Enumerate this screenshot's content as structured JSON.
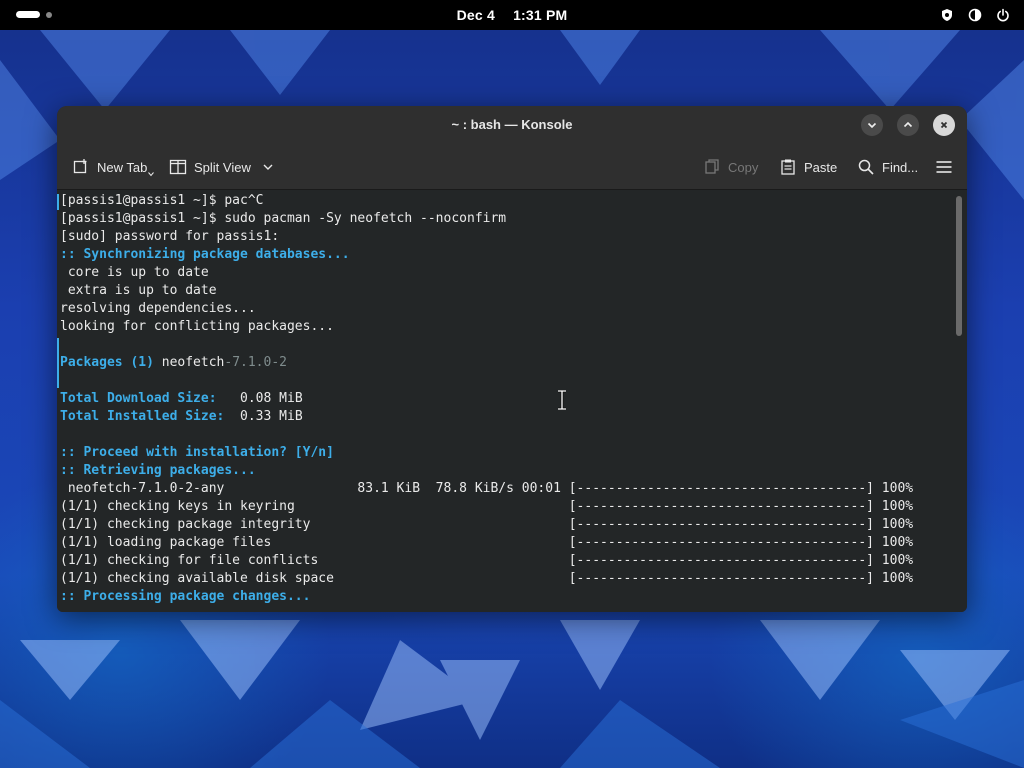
{
  "topbar": {
    "date": "Dec 4",
    "time": "1:31 PM",
    "tray_icons": [
      "shield-icon",
      "volume-icon",
      "power-icon"
    ]
  },
  "window": {
    "title": "~ : bash — Konsole",
    "controls": [
      "minimize",
      "maximize",
      "close"
    ]
  },
  "toolbar": {
    "new_tab": "New Tab",
    "split_view": "Split View",
    "copy": "Copy",
    "paste": "Paste",
    "find": "Find..."
  },
  "terminal": {
    "lines": [
      [
        {
          "t": "[passis1@passis1 ~]$ pac^C",
          "c": ""
        }
      ],
      [
        {
          "t": "[passis1@passis1 ~]$ sudo pacman -Sy neofetch --noconfirm",
          "c": ""
        }
      ],
      [
        {
          "t": "[sudo] password for passis1:",
          "c": ""
        }
      ],
      [
        {
          "t": ":: Synchronizing package databases...",
          "c": "blue"
        }
      ],
      [
        {
          "t": " core is up to date",
          "c": ""
        }
      ],
      [
        {
          "t": " extra is up to date",
          "c": ""
        }
      ],
      [
        {
          "t": "resolving dependencies...",
          "c": ""
        }
      ],
      [
        {
          "t": "looking for conflicting packages...",
          "c": ""
        }
      ],
      [
        {
          "t": "",
          "c": ""
        }
      ],
      [
        {
          "t": "Packages (1) ",
          "c": "blue"
        },
        {
          "t": "neofetch",
          "c": ""
        },
        {
          "t": "-7.1.0-2",
          "c": "gray"
        }
      ],
      [
        {
          "t": "",
          "c": ""
        }
      ],
      [
        {
          "t": "Total Download Size:",
          "c": "blue"
        },
        {
          "t": "   0.08 MiB",
          "c": ""
        }
      ],
      [
        {
          "t": "Total Installed Size:",
          "c": "blue"
        },
        {
          "t": "  0.33 MiB",
          "c": ""
        }
      ],
      [
        {
          "t": "",
          "c": ""
        }
      ],
      [
        {
          "t": ":: Proceed with installation? [Y/n]",
          "c": "blue"
        }
      ],
      [
        {
          "t": ":: Retrieving packages...",
          "c": "blue"
        }
      ],
      [
        {
          "t": " neofetch-7.1.0-2-any                 83.1 KiB  78.8 KiB/s 00:01 [-------------------------------------] 100%",
          "c": ""
        }
      ],
      [
        {
          "t": "(1/1) checking keys in keyring                                   [-------------------------------------] 100%",
          "c": ""
        }
      ],
      [
        {
          "t": "(1/1) checking package integrity                                 [-------------------------------------] 100%",
          "c": ""
        }
      ],
      [
        {
          "t": "(1/1) loading package files                                      [-------------------------------------] 100%",
          "c": ""
        }
      ],
      [
        {
          "t": "(1/1) checking for file conflicts                                [-------------------------------------] 100%",
          "c": ""
        }
      ],
      [
        {
          "t": "(1/1) checking available disk space                              [-------------------------------------] 100%",
          "c": ""
        }
      ],
      [
        {
          "t": ":: Processing package changes...",
          "c": "blue"
        }
      ]
    ]
  }
}
